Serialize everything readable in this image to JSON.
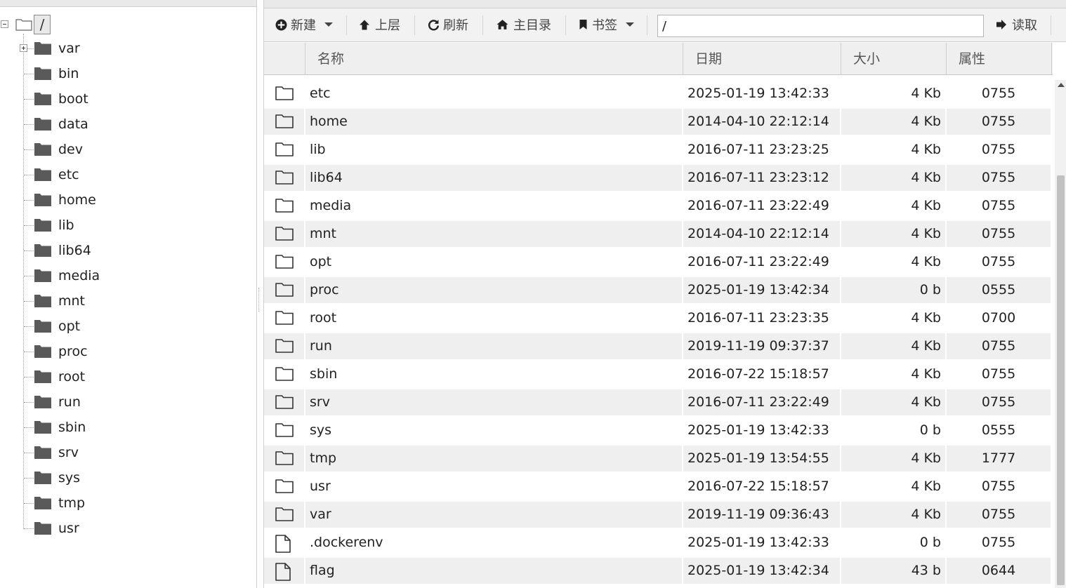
{
  "tree": {
    "root_label": "/",
    "items": [
      {
        "label": "var"
      },
      {
        "label": "bin"
      },
      {
        "label": "boot"
      },
      {
        "label": "data"
      },
      {
        "label": "dev"
      },
      {
        "label": "etc"
      },
      {
        "label": "home"
      },
      {
        "label": "lib"
      },
      {
        "label": "lib64"
      },
      {
        "label": "media"
      },
      {
        "label": "mnt"
      },
      {
        "label": "opt"
      },
      {
        "label": "proc"
      },
      {
        "label": "root"
      },
      {
        "label": "run"
      },
      {
        "label": "sbin"
      },
      {
        "label": "srv"
      },
      {
        "label": "sys"
      },
      {
        "label": "tmp"
      },
      {
        "label": "usr"
      }
    ]
  },
  "toolbar": {
    "new_label": "新建",
    "up_label": "上层",
    "refresh_label": "刷新",
    "home_label": "主目录",
    "bookmark_label": "书签",
    "path_value": "/",
    "read_label": "读取"
  },
  "grid": {
    "columns": {
      "name": "名称",
      "date": "日期",
      "size": "大小",
      "attr": "属性"
    },
    "rows": [
      {
        "type": "folder",
        "name": "etc",
        "date": "2025-01-19 13:42:33",
        "size": "4 Kb",
        "attr": "0755"
      },
      {
        "type": "folder",
        "name": "home",
        "date": "2014-04-10 22:12:14",
        "size": "4 Kb",
        "attr": "0755"
      },
      {
        "type": "folder",
        "name": "lib",
        "date": "2016-07-11 23:23:25",
        "size": "4 Kb",
        "attr": "0755"
      },
      {
        "type": "folder",
        "name": "lib64",
        "date": "2016-07-11 23:23:12",
        "size": "4 Kb",
        "attr": "0755"
      },
      {
        "type": "folder",
        "name": "media",
        "date": "2016-07-11 23:22:49",
        "size": "4 Kb",
        "attr": "0755"
      },
      {
        "type": "folder",
        "name": "mnt",
        "date": "2014-04-10 22:12:14",
        "size": "4 Kb",
        "attr": "0755"
      },
      {
        "type": "folder",
        "name": "opt",
        "date": "2016-07-11 23:22:49",
        "size": "4 Kb",
        "attr": "0755"
      },
      {
        "type": "folder",
        "name": "proc",
        "date": "2025-01-19 13:42:34",
        "size": "0 b",
        "attr": "0555"
      },
      {
        "type": "folder",
        "name": "root",
        "date": "2016-07-11 23:23:35",
        "size": "4 Kb",
        "attr": "0700"
      },
      {
        "type": "folder",
        "name": "run",
        "date": "2019-11-19 09:37:37",
        "size": "4 Kb",
        "attr": "0755"
      },
      {
        "type": "folder",
        "name": "sbin",
        "date": "2016-07-22 15:18:57",
        "size": "4 Kb",
        "attr": "0755"
      },
      {
        "type": "folder",
        "name": "srv",
        "date": "2016-07-11 23:22:49",
        "size": "4 Kb",
        "attr": "0755"
      },
      {
        "type": "folder",
        "name": "sys",
        "date": "2025-01-19 13:42:33",
        "size": "0 b",
        "attr": "0555"
      },
      {
        "type": "folder",
        "name": "tmp",
        "date": "2025-01-19 13:54:55",
        "size": "4 Kb",
        "attr": "1777"
      },
      {
        "type": "folder",
        "name": "usr",
        "date": "2016-07-22 15:18:57",
        "size": "4 Kb",
        "attr": "0755"
      },
      {
        "type": "folder",
        "name": "var",
        "date": "2019-11-19 09:36:43",
        "size": "4 Kb",
        "attr": "0755"
      },
      {
        "type": "file",
        "name": ".dockerenv",
        "date": "2025-01-19 13:42:33",
        "size": "0 b",
        "attr": "0755"
      },
      {
        "type": "file",
        "name": "flag",
        "date": "2025-01-19 13:42:34",
        "size": "43 b",
        "attr": "0644"
      }
    ]
  }
}
